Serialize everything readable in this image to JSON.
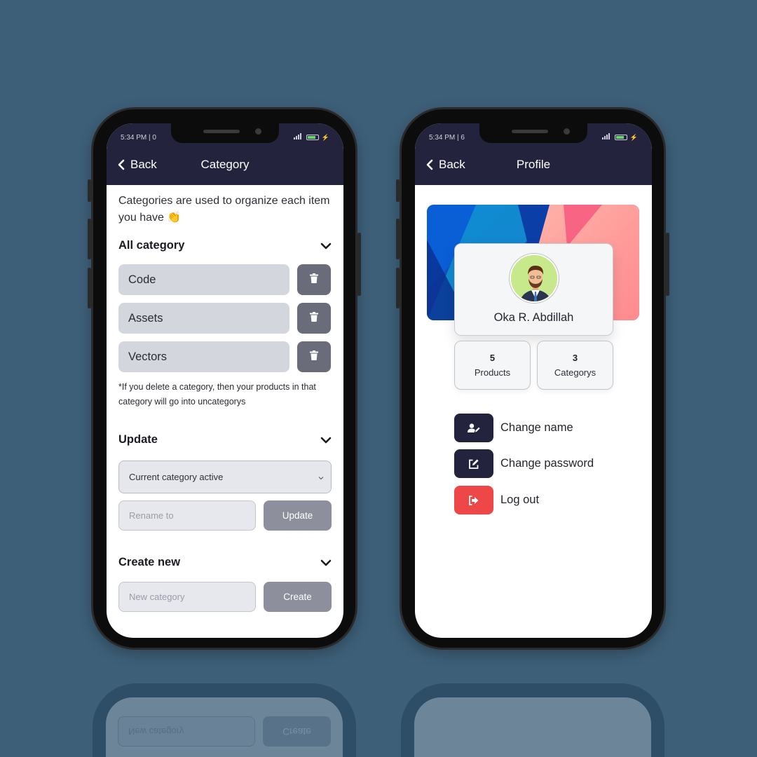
{
  "category_screen": {
    "status_time": "5:34 PM | 0",
    "back_label": "Back",
    "title": "Category",
    "intro_text": "Categories are used to organize each item you have 👏",
    "all_category": {
      "heading": "All category",
      "items": [
        {
          "label": "Code"
        },
        {
          "label": "Assets"
        },
        {
          "label": "Vectors"
        }
      ],
      "note": "*If you delete a category, then your products in that category will go into uncategorys"
    },
    "update": {
      "heading": "Update",
      "select_value": "Current category active",
      "rename_placeholder": "Rename to",
      "button_label": "Update"
    },
    "create": {
      "heading": "Create new",
      "input_placeholder": "New category",
      "button_label": "Create"
    }
  },
  "profile_screen": {
    "status_time": "5:34 PM | 6",
    "back_label": "Back",
    "title": "Profile",
    "user_name": "Oka R. Abdillah",
    "stats": [
      {
        "value": "5",
        "label": "Products"
      },
      {
        "value": "3",
        "label": "Categorys"
      }
    ],
    "menu": [
      {
        "label": "Change name",
        "icon": "user-edit-icon"
      },
      {
        "label": "Change password",
        "icon": "edit-icon"
      },
      {
        "label": "Log out",
        "icon": "logout-icon"
      }
    ]
  },
  "reflection": {
    "input_placeholder": "New category",
    "button_label": "Create"
  },
  "colors": {
    "background": "#3d5f78",
    "appbar": "#23233d",
    "danger": "#ee4747",
    "pill": "#d4d6dd",
    "button_gray": "#8d8f9d"
  }
}
